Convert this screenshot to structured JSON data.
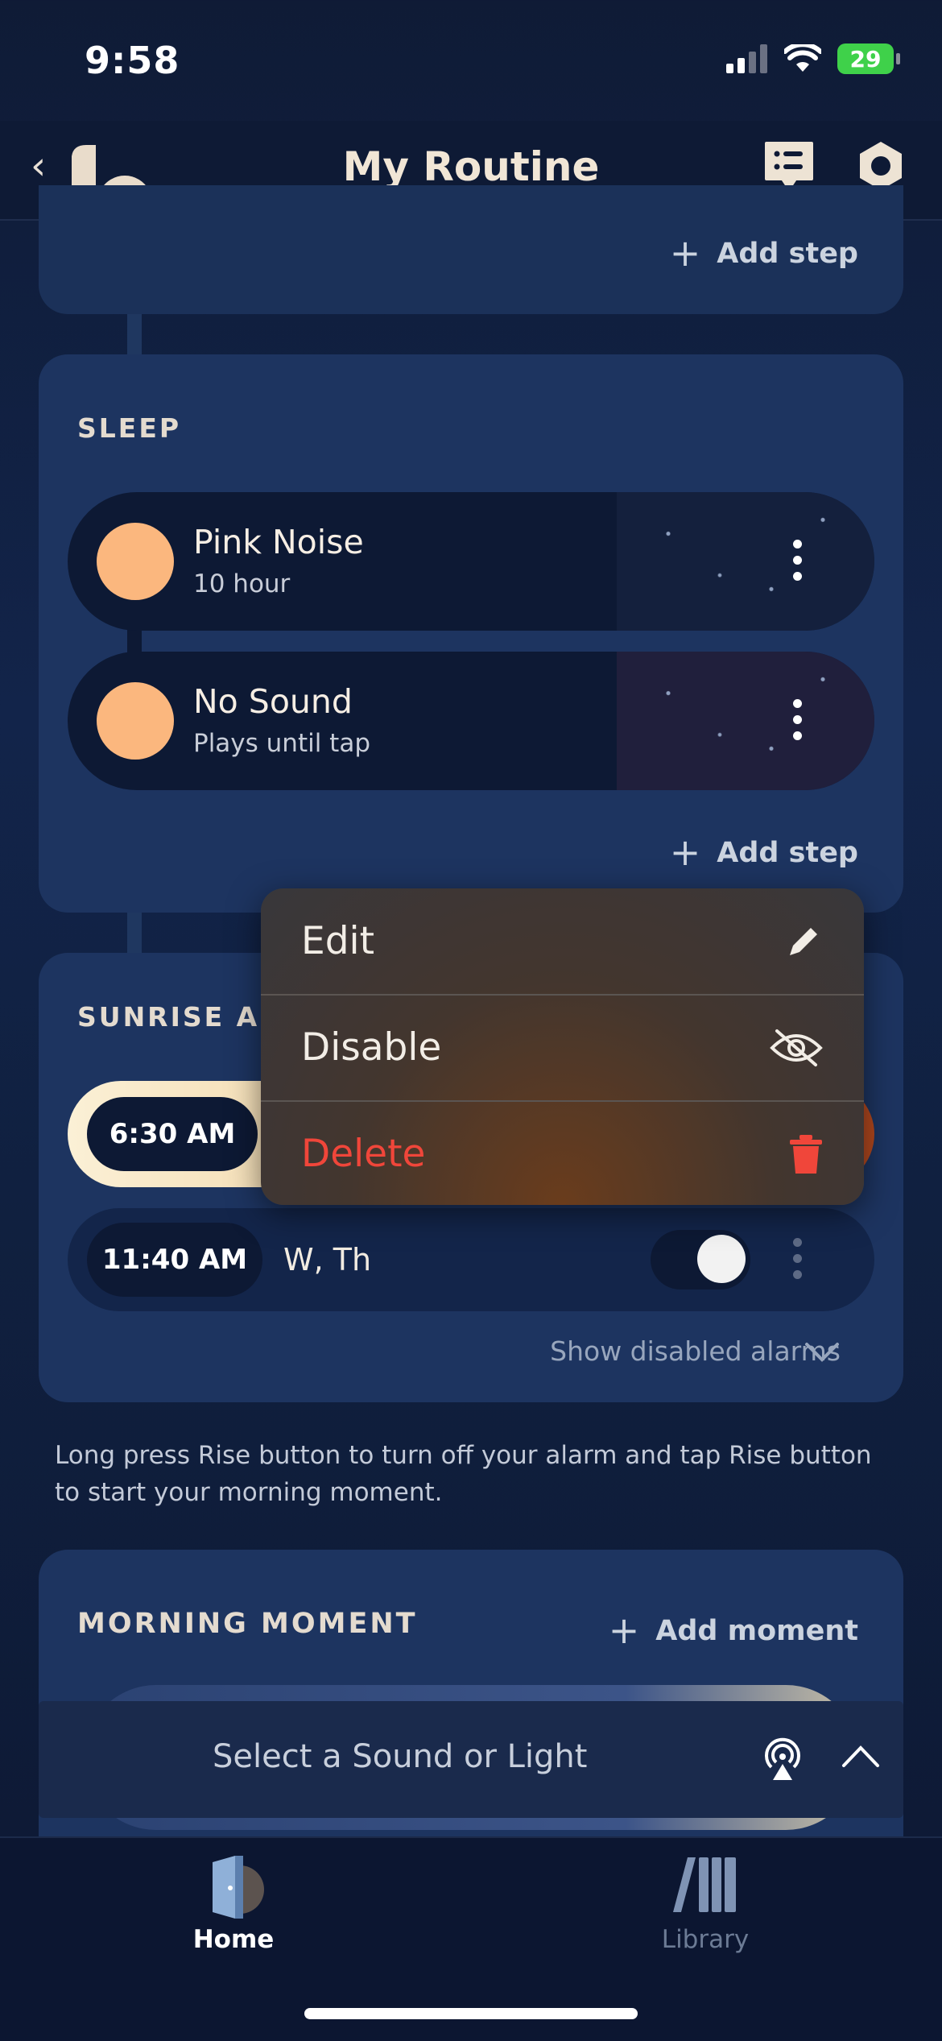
{
  "status_bar": {
    "time": "9:58",
    "battery": "29"
  },
  "header": {
    "title": "My Routine"
  },
  "top_section": {
    "add_step_label": "Add step"
  },
  "sleep": {
    "title": "SLEEP",
    "items": [
      {
        "title": "Pink Noise",
        "subtitle": "10 hour"
      },
      {
        "title": "No Sound",
        "subtitle": "Plays until tap"
      }
    ],
    "add_step_label": "Add step"
  },
  "context_menu": {
    "items": [
      {
        "label": "Edit",
        "icon": "pencil-icon",
        "color": "#f2ede6"
      },
      {
        "label": "Disable",
        "icon": "eye-slash-icon",
        "color": "#f2ede6"
      },
      {
        "label": "Delete",
        "icon": "trash-icon",
        "color": "#f0463a"
      }
    ]
  },
  "sunrise": {
    "title_visible": "SUNRISE AL",
    "alarms": [
      {
        "time": "6:30 AM",
        "days": "",
        "enabled": true
      },
      {
        "time": "11:40 AM",
        "days": "W, Th",
        "enabled": true
      }
    ],
    "show_disabled_label": "Show disabled alarms"
  },
  "note": "Long press Rise button to turn off your alarm and tap Rise button to start your morning moment.",
  "morning_moment": {
    "title": "MORNING MOMENT",
    "add_label": "Add moment"
  },
  "player": {
    "label": "Select a Sound or Light"
  },
  "tabs": [
    {
      "label": "Home",
      "active": true,
      "color": "#ffffff"
    },
    {
      "label": "Library",
      "active": false,
      "color": "#6c7b95"
    }
  ]
}
